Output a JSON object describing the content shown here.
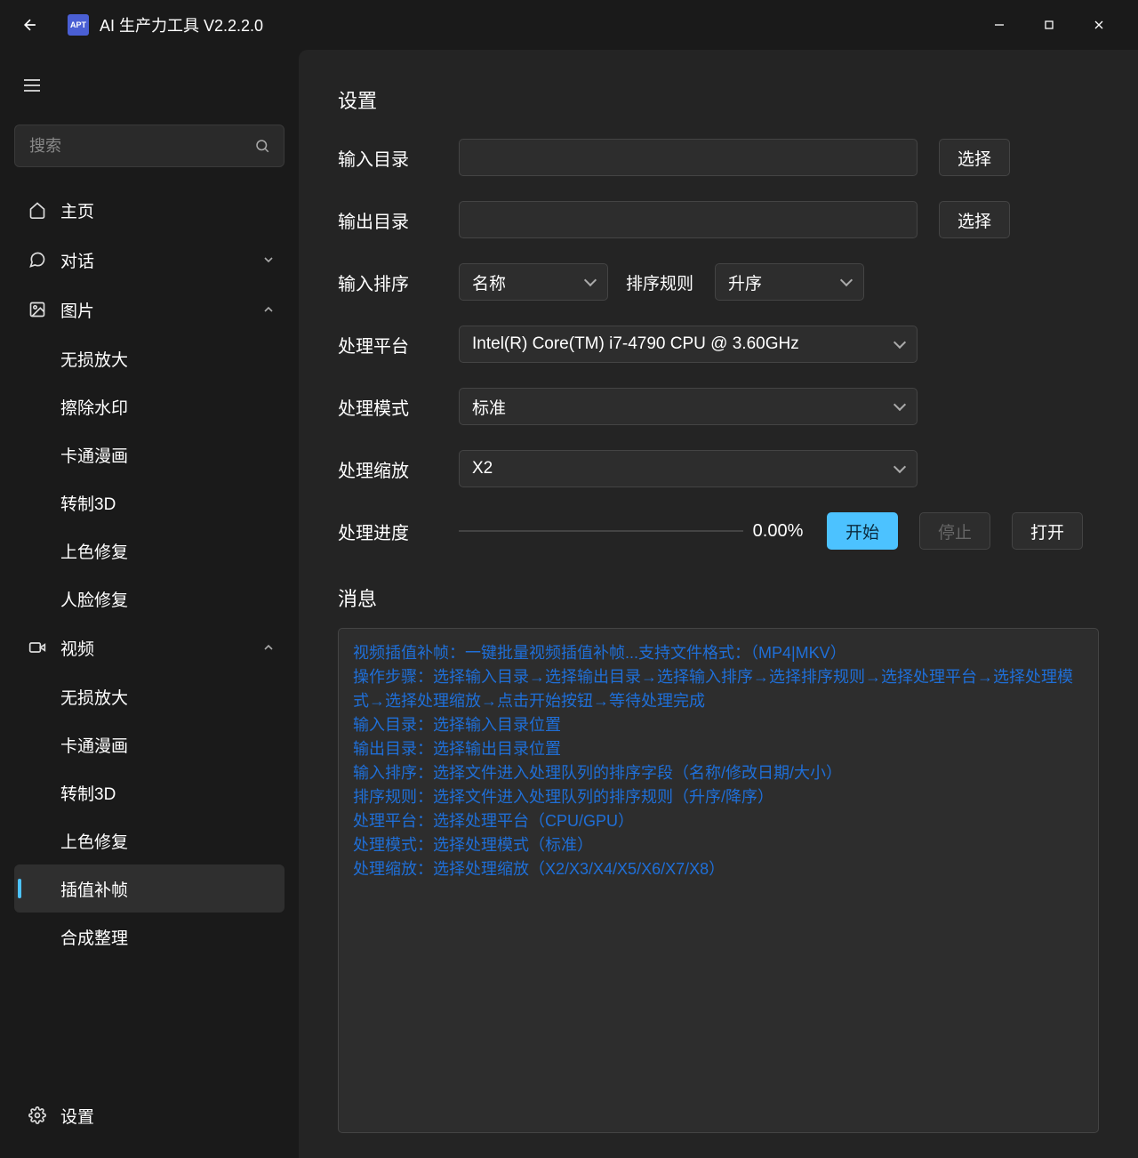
{
  "app": {
    "icon_text": "APT",
    "title": "AI 生产力工具 V2.2.2.0"
  },
  "search": {
    "placeholder": "搜索"
  },
  "sidebar": {
    "home_label": "主页",
    "chat_label": "对话",
    "image_label": "图片",
    "image_subs": [
      "无损放大",
      "擦除水印",
      "卡通漫画",
      "转制3D",
      "上色修复",
      "人脸修复"
    ],
    "video_label": "视频",
    "video_subs": [
      "无损放大",
      "卡通漫画",
      "转制3D",
      "上色修复",
      "插值补帧",
      "合成整理"
    ],
    "settings_label": "设置"
  },
  "settings": {
    "title": "设置",
    "input_dir_label": "输入目录",
    "output_dir_label": "输出目录",
    "select_btn": "选择",
    "input_sort_label": "输入排序",
    "input_sort_value": "名称",
    "sort_rule_label": "排序规则",
    "sort_rule_value": "升序",
    "platform_label": "处理平台",
    "platform_value": "Intel(R) Core(TM) i7-4790 CPU @ 3.60GHz",
    "mode_label": "处理模式",
    "mode_value": "标准",
    "scale_label": "处理缩放",
    "scale_value": "X2",
    "progress_label": "处理进度",
    "progress_text": "0.00%",
    "start_btn": "开始",
    "stop_btn": "停止",
    "open_btn": "打开"
  },
  "message": {
    "title": "消息",
    "body": "视频插值补帧：一键批量视频插值补帧...支持文件格式：（MP4|MKV）\n操作步骤：选择输入目录→选择输出目录→选择输入排序→选择排序规则→选择处理平台→选择处理模式→选择处理缩放→点击开始按钮→等待处理完成\n输入目录：选择输入目录位置\n输出目录：选择输出目录位置\n输入排序：选择文件进入处理队列的排序字段（名称/修改日期/大小）\n排序规则：选择文件进入处理队列的排序规则（升序/降序）\n处理平台：选择处理平台（CPU/GPU）\n处理模式：选择处理模式（标准）\n处理缩放：选择处理缩放（X2/X3/X4/X5/X6/X7/X8）"
  }
}
